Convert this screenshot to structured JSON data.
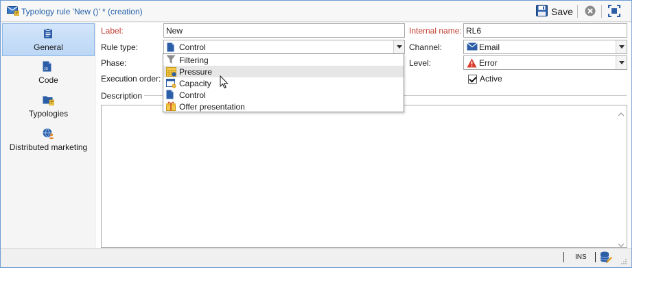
{
  "window": {
    "title": "Typology rule 'New ()' * (creation)",
    "save_label": "Save"
  },
  "nav": {
    "items": [
      {
        "label": "General",
        "icon": "clipboard-icon",
        "active": true
      },
      {
        "label": "Code",
        "icon": "js-file-icon"
      },
      {
        "label": "Typologies",
        "icon": "folder-typology-icon"
      },
      {
        "label": "Distributed marketing",
        "icon": "globe-user-icon"
      }
    ]
  },
  "form": {
    "label_label": "Label:",
    "label_value": "New",
    "internal_name_label": "Internal name:",
    "internal_name_value": "RL6",
    "rule_type_label": "Rule type:",
    "rule_type_value": "Control",
    "channel_label": "Channel:",
    "channel_value": "Email",
    "phase_label": "Phase:",
    "level_label": "Level:",
    "level_value": "Error",
    "execution_order_label": "Execution order:",
    "active_label": "Active",
    "active_checked": true,
    "description_label": "Description"
  },
  "rule_type_options": [
    {
      "label": "Filtering",
      "icon": "funnel-icon"
    },
    {
      "label": "Pressure",
      "icon": "calendar-grid-icon",
      "highlighted": true
    },
    {
      "label": "Capacity",
      "icon": "calendar-gear-icon"
    },
    {
      "label": "Control",
      "icon": "js-file-icon"
    },
    {
      "label": "Offer presentation",
      "icon": "gift-icon"
    }
  ],
  "statusbar": {
    "mode": "INS"
  },
  "colors": {
    "title_text": "#2561a8",
    "required_label": "#c0392b",
    "nav_active": "#bcd7f5",
    "window_border": "#6e9cd3"
  }
}
